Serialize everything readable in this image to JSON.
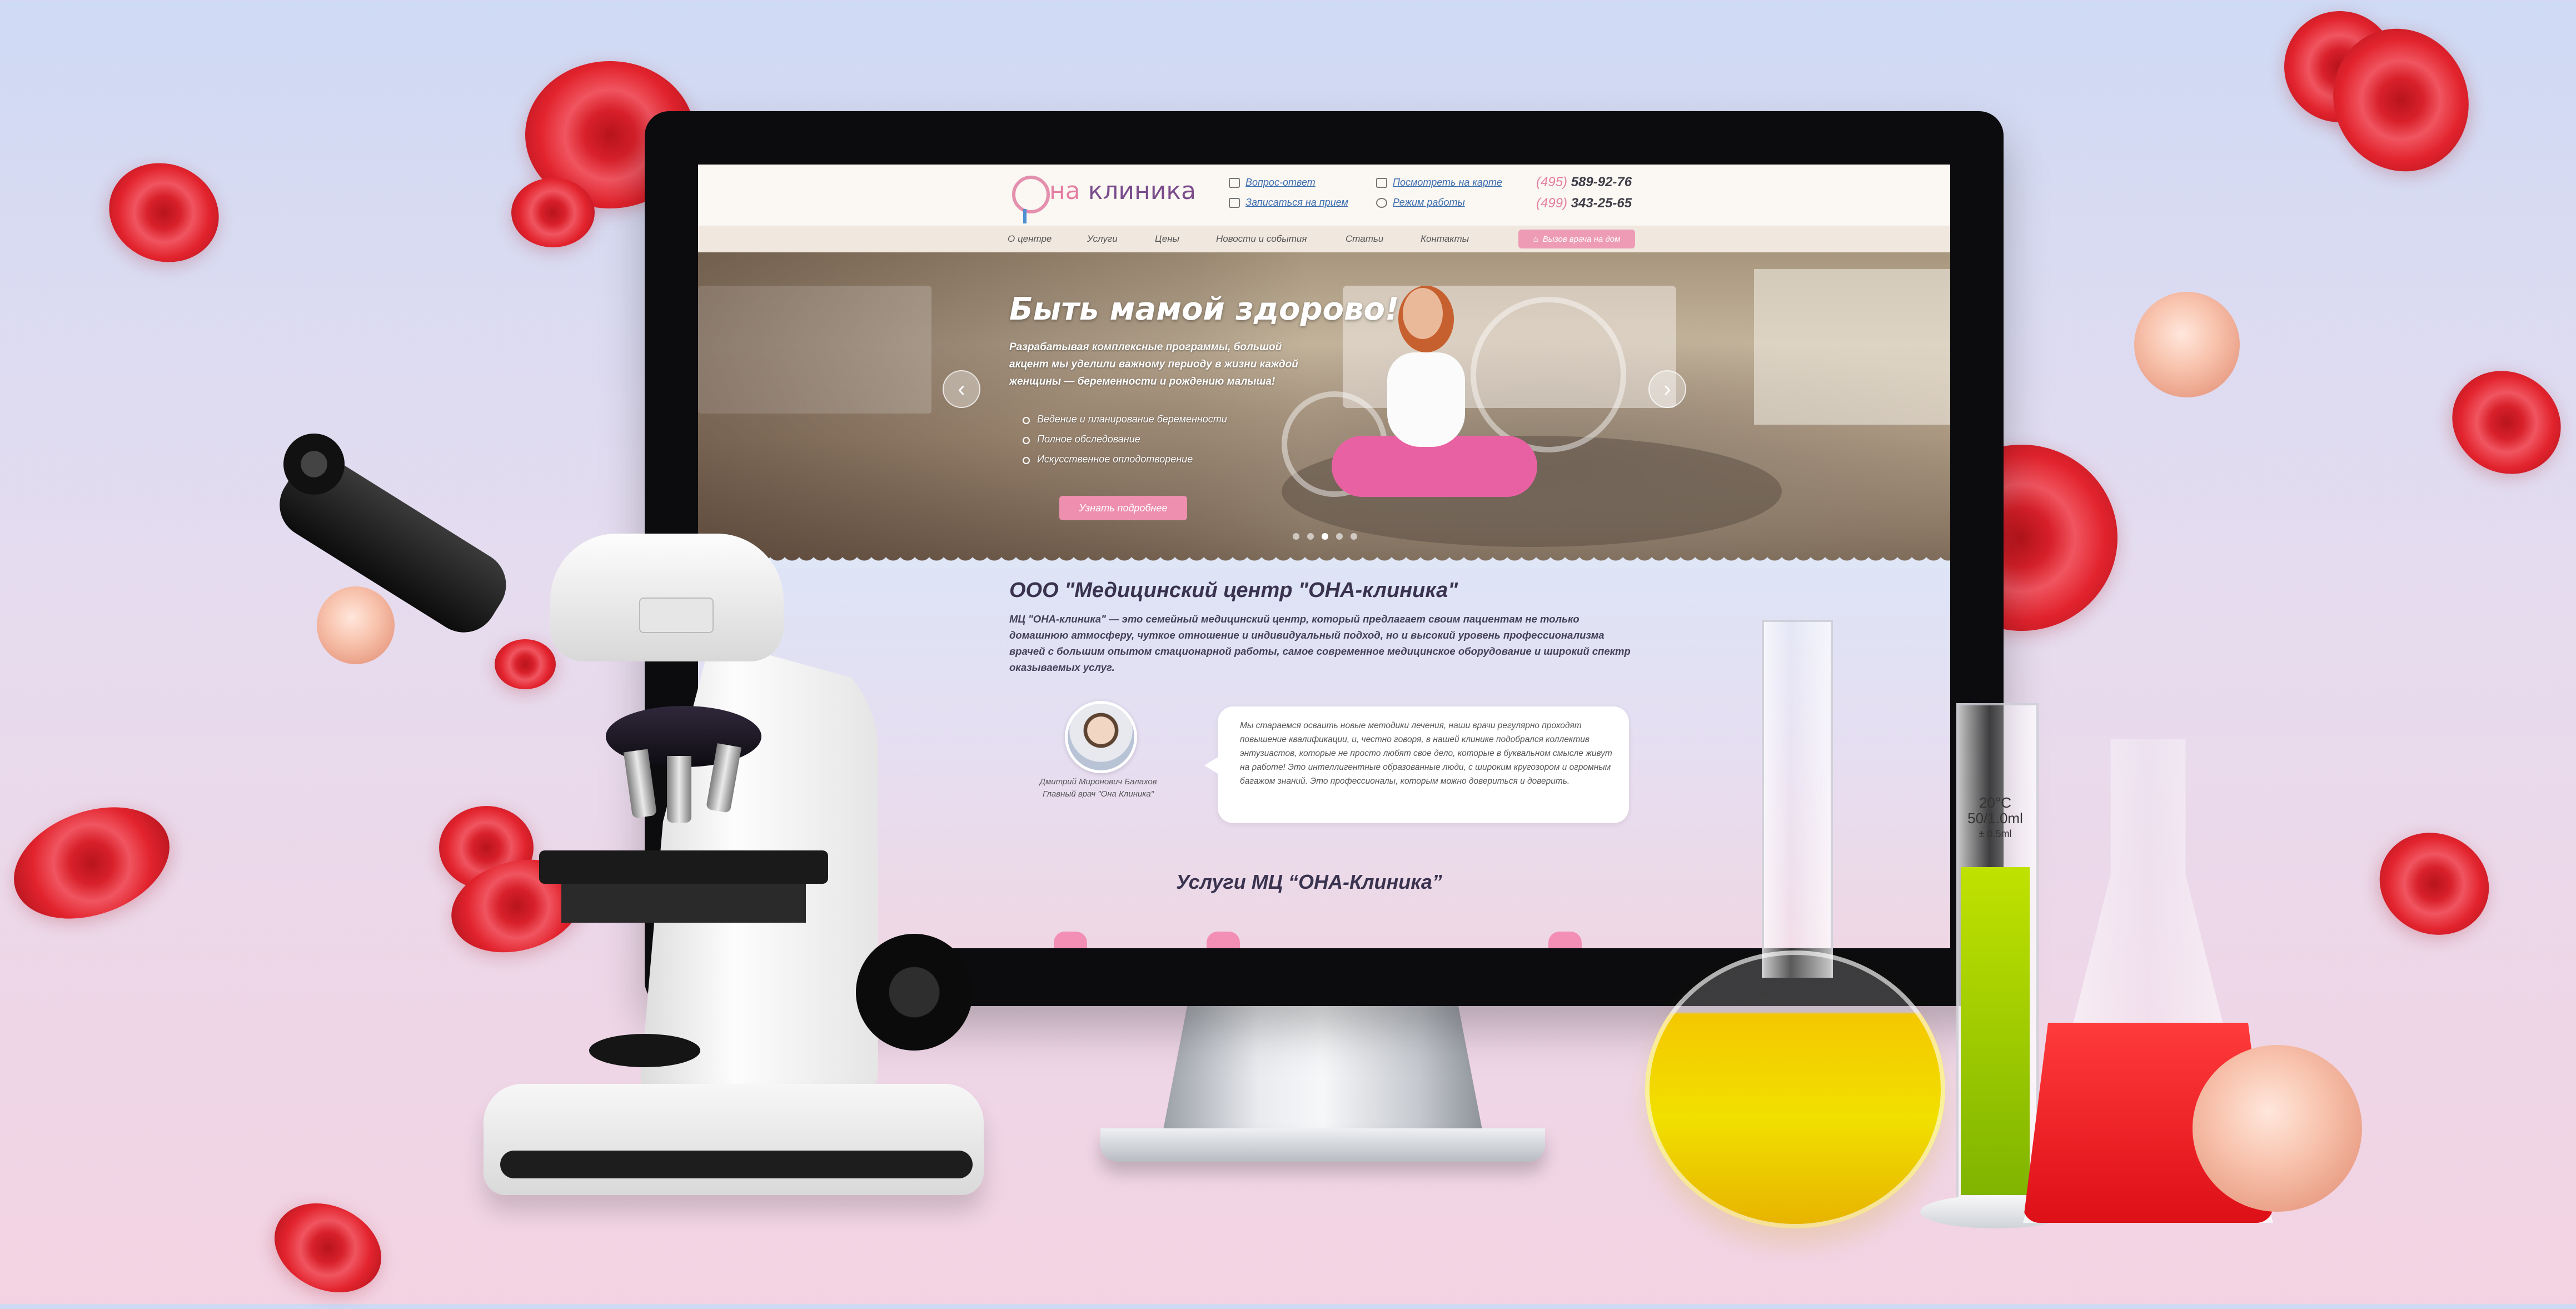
{
  "site": {
    "logo": {
      "mark": "О",
      "name_part1": "на",
      "name_part2": " клиника"
    },
    "header_links": {
      "question": "Вопрос-ответ",
      "appointment": "Записаться на прием",
      "map": "Посмотреть на карте",
      "schedule": "Режим работы"
    },
    "phones": [
      {
        "code": "(495)",
        "number": " 589-92-76"
      },
      {
        "code": "(499)",
        "number": " 343-25-65"
      }
    ],
    "nav": [
      "О центре",
      "Услуги",
      "Цены",
      "Новости и события",
      "Статьи",
      "Контакты"
    ],
    "nav_cta": "Вызов врача на дом",
    "hero": {
      "title": "Быть мамой здорово!",
      "subtitle": "Разрабатывая комплексные программы, большой акцент мы уделили важному периоду в жизни каждой женщины — беременности и рождению малыша!",
      "list": [
        "Ведение и планирование беременности",
        "Полное обследование",
        "Искусственное оплодотворение"
      ],
      "button": "Узнать подробнее",
      "prev_arrow": "‹",
      "next_arrow": "›",
      "slides_count": 5,
      "active_slide": 3
    },
    "about": {
      "title": "ООО \"Медицинский центр \"ОНА-клиника\"",
      "text": "МЦ \"ОНА-клиника\" — это семейный медицинский центр, который предлагает своим пациентам не только домашнюю атмосферу, чуткое отношение и индивидуальный подход, но и высокий уровень профессионализма врачей с большим опытом стационарной работы, самое современное медицинское оборудование и широкий спектр оказываемых услуг.",
      "doctor_name": "Дмитрий Миронович Балахов",
      "doctor_role": "Главный врач \"Она Клиника\"",
      "quote": "Мы стараемся осваить новые методики лечения, наши врачи регулярно проходят повышение квалификации, и, честно говоря, в нашей клинике подобрался коллектив энтузиастов, которые не просто любят свое дело, которые в буквальном смысле живут на работе! Это интеллигентные образованные люди, с широким кругозором и огромным багажом знаний. Это профессионалы, которым можно довериться и доверить."
    },
    "services_title": "Услуги МЦ “ОНА-Клиника”"
  },
  "lab": {
    "cylinder_label": [
      "20°C",
      "50/1.0ml",
      "± 0.5ml"
    ]
  },
  "colors": {
    "accent_pink": "#ee8fb0",
    "logo_purple": "#7a4c8c",
    "link_blue": "#3d6fb0",
    "cell_red": "#d8202a",
    "liquid_yellow": "#f1e000",
    "liquid_green": "#9ccc00",
    "liquid_red": "#e0141b"
  }
}
